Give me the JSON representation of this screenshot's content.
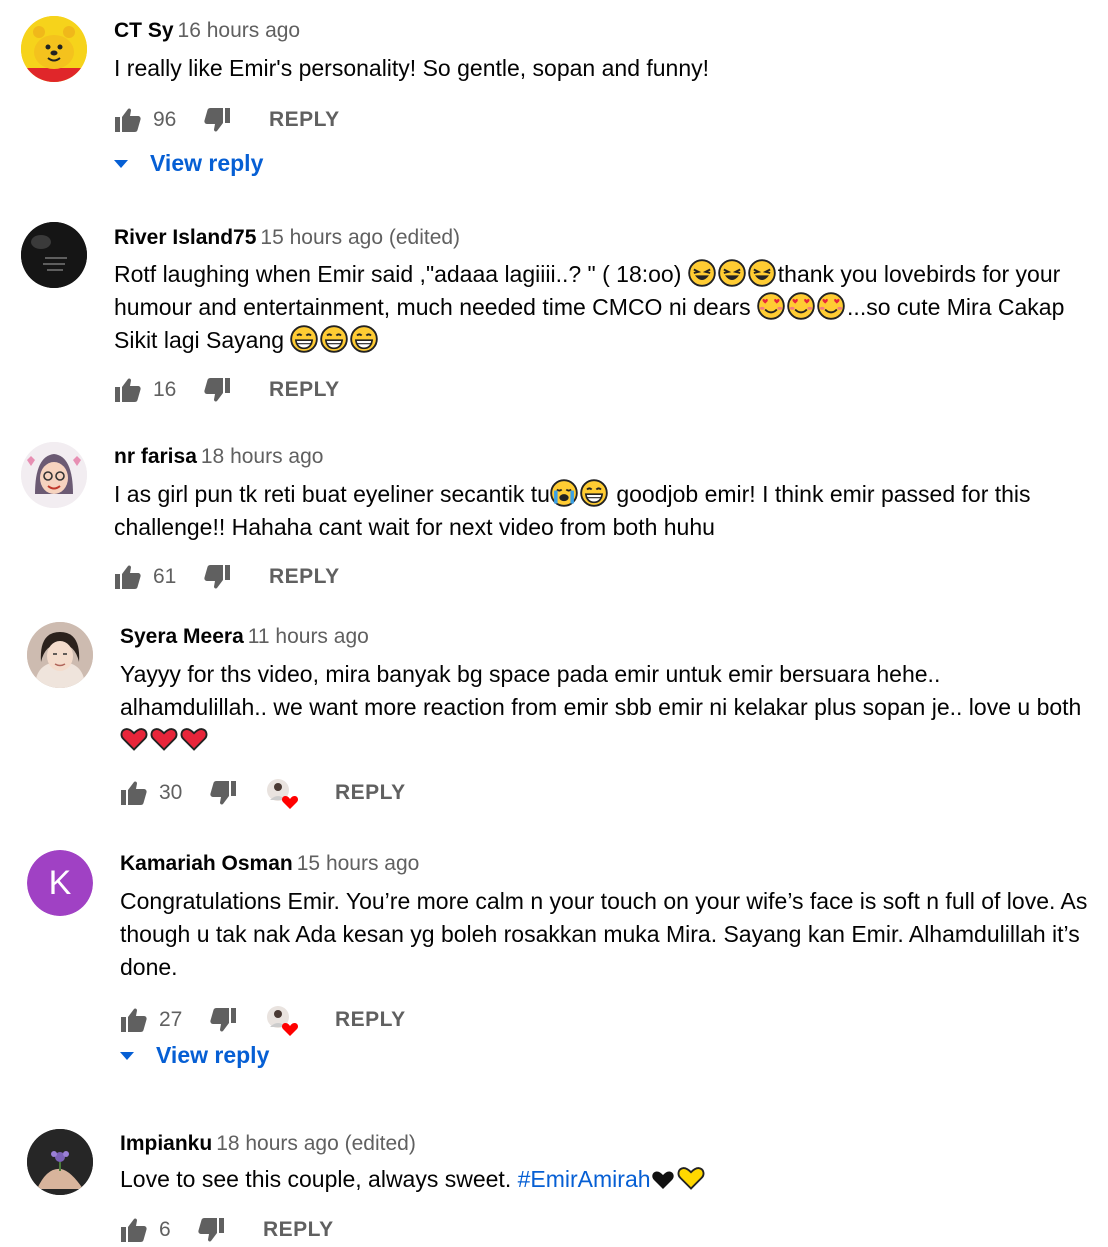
{
  "comments": [
    {
      "author": "CT Sy",
      "time": "16 hours ago",
      "text_parts": [
        "I really like Emir's personality! So gentle, sopan and funny!"
      ],
      "likes": "96",
      "reply_label": "REPLY",
      "view_reply": "View reply",
      "avatar_desc": "winnie-the-pooh-face-avatar"
    },
    {
      "author": "River Island75",
      "time": "15 hours ago (edited)",
      "text_parts": [
        "Rotf laughing when Emir said ,\"adaaa lagiiii..? \" ( 18:oo) ",
        "thank you lovebirds for your humour and entertainment, much needed time CMCO ni dears ",
        "...so cute Mira Cakap Sikit lagi Sayang "
      ],
      "likes": "16",
      "reply_label": "REPLY",
      "avatar_desc": "dark-photo-avatar"
    },
    {
      "author": "nr farisa",
      "time": "18 hours ago",
      "text_parts": [
        "I as girl pun tk reti buat eyeliner secantik tu",
        " goodjob emir! I think emir passed for this challenge!! Hahaha cant wait for next video from both huhu"
      ],
      "likes": "61",
      "reply_label": "REPLY",
      "avatar_desc": "cartoon-hijab-girl-avatar"
    },
    {
      "author": "Syera Meera",
      "time": "11 hours ago",
      "text_parts": [
        "Yayyy for ths video, mira banyak bg space pada emir untuk emir bersuara hehe.. alhamdulillah.. we want more reaction from emir sbb emir ni kelakar plus sopan je.. love u both "
      ],
      "likes": "30",
      "reply_label": "REPLY",
      "avatar_desc": "woman-photo-avatar"
    },
    {
      "author": "Kamariah Osman",
      "time": "15 hours ago",
      "text_parts": [
        "Congratulations Emir. You’re more calm n your touch on your wife’s face is soft n full of love. As though u tak nak Ada kesan yg boleh rosakkan muka Mira. Sayang kan Emir. Alhamdulillah it’s done."
      ],
      "likes": "27",
      "reply_label": "REPLY",
      "view_reply": "View reply",
      "avatar_letter": "K",
      "avatar_color": "#a041c4"
    },
    {
      "author": "Impianku",
      "time": "18 hours ago (edited)",
      "text_parts": [
        "Love to see this couple, always sweet. ",
        "#EmirAmirah"
      ],
      "likes": "6",
      "reply_label": "REPLY",
      "avatar_desc": "hand-with-flower-photo-avatar"
    }
  ],
  "colors": {
    "link_blue": "#065fd4",
    "meta_gray": "#606060",
    "heart_red": "#ff0000"
  }
}
